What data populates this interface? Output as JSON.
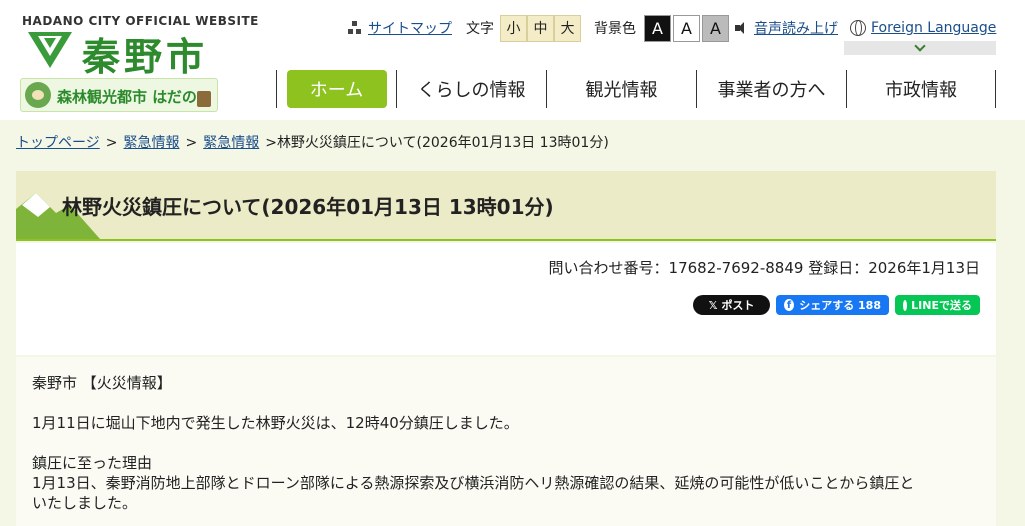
{
  "header": {
    "site_caption": "HADANO CITY OFFICIAL WEBSITE",
    "logo_text": "秦野市",
    "banner_text": "森林観光都市 はだの"
  },
  "utility": {
    "sitemap": "サイトマップ",
    "fontsize_label": "文字",
    "fontsize_small": "小",
    "fontsize_medium": "中",
    "fontsize_large": "大",
    "bgcolor_label": "背景色",
    "bg_black": "A",
    "bg_white": "A",
    "bg_grey": "A",
    "voice": "音声読み上げ",
    "foreign": "Foreign Language"
  },
  "nav": {
    "home": "ホーム",
    "living": "くらしの情報",
    "tourism": "観光情報",
    "business": "事業者の方へ",
    "admin": "市政情報"
  },
  "breadcrumb": {
    "top": "トップページ",
    "emergency1": "緊急情報",
    "emergency2": "緊急情報",
    "current": "林野火災鎮圧について(2026年01月13日 13時01分)"
  },
  "page": {
    "title": "林野火災鎮圧について(2026年01月13日 13時01分)",
    "meta": "問い合わせ番号：17682-7692-8849 登録日：2026年1月13日"
  },
  "share": {
    "x": "ポスト",
    "facebook": "シェアする 188",
    "line": "LINEで送る"
  },
  "body": {
    "line1": "秦野市 【火災情報】",
    "line2": "1月11日に堀山下地内で発生した林野火災は、12時40分鎮圧しました。",
    "line3": "鎮圧に至った理由",
    "line4": "1月13日、秦野消防地上部隊とドローン部隊による熱源探索及び横浜消防ヘリ熱源確認の結果、延焼の可能性が低いことから鎮圧と",
    "line5": "いたしました。"
  },
  "colors": {
    "accent_green": "#8dc21f",
    "logo_green": "#2d8a2d",
    "link_blue": "#1a4e8a",
    "title_bg": "#ecebc7",
    "page_bg": "#f4f6e6"
  }
}
